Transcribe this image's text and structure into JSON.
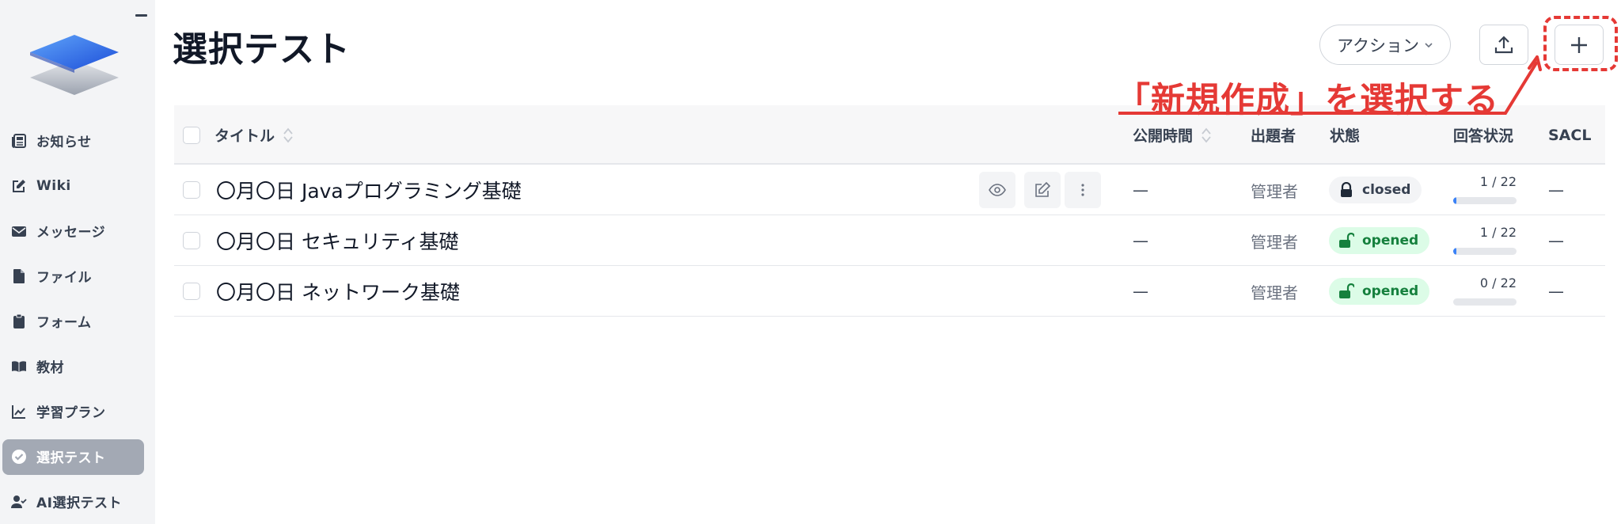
{
  "sidebar": {
    "items": [
      {
        "label": "お知らせ",
        "icon": "newspaper-icon",
        "active": false
      },
      {
        "label": "Wiki",
        "icon": "edit-icon",
        "active": false
      },
      {
        "label": "メッセージ",
        "icon": "envelope-icon",
        "active": false
      },
      {
        "label": "ファイル",
        "icon": "file-icon",
        "active": false
      },
      {
        "label": "フォーム",
        "icon": "clipboard-icon",
        "active": false
      },
      {
        "label": "教材",
        "icon": "book-icon",
        "active": false
      },
      {
        "label": "学習プラン",
        "icon": "chart-line-icon",
        "active": false
      },
      {
        "label": "選択テスト",
        "icon": "check-circle-icon",
        "active": true
      },
      {
        "label": "AI選択テスト",
        "icon": "user-check-icon",
        "active": false
      }
    ]
  },
  "header": {
    "title": "選択テスト",
    "action_label": "アクション"
  },
  "annotation": {
    "text": "「新規作成」を選択する",
    "color": "#e53935"
  },
  "table": {
    "columns": {
      "title": "タイトル",
      "published": "公開時間",
      "author": "出題者",
      "status": "状態",
      "answers": "回答状況",
      "sacl": "SACL"
    },
    "rows": [
      {
        "title": "〇月〇日 Javaプログラミング基礎",
        "published": "—",
        "author": "管理者",
        "status": "closed",
        "answers": "1 / 22",
        "progress": 0.045,
        "sacl": "—"
      },
      {
        "title": "〇月〇日 セキュリティ基礎",
        "published": "—",
        "author": "管理者",
        "status": "opened",
        "answers": "1 / 22",
        "progress": 0.045,
        "sacl": "—"
      },
      {
        "title": "〇月〇日 ネットワーク基礎",
        "published": "—",
        "author": "管理者",
        "status": "opened",
        "answers": "0 / 22",
        "progress": 0,
        "sacl": "—"
      }
    ]
  },
  "colors": {
    "active_nav": "#a3a9b4",
    "opened_badge_bg": "#dcfce7",
    "opened_badge_text": "#15803d",
    "progress": "#3b82f6"
  }
}
